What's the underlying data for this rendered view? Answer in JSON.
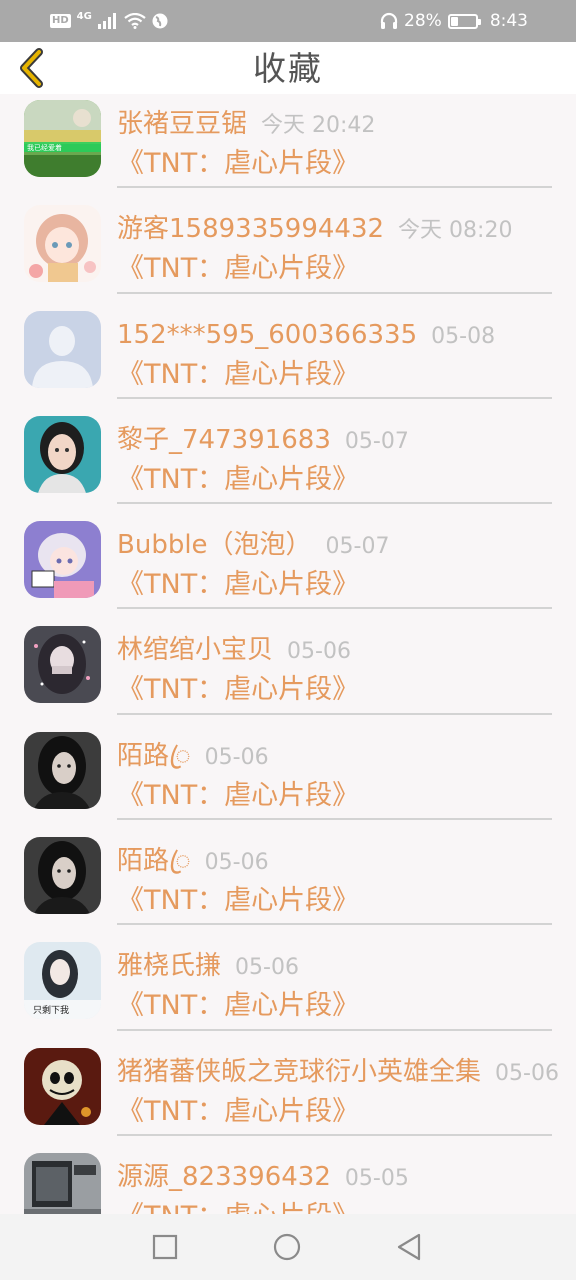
{
  "status_bar": {
    "hd": "HD",
    "network": "4G",
    "battery_text": "28%",
    "battery_level": 0.28,
    "time": "8:43",
    "icons": [
      "signal-icon",
      "wifi-icon",
      "globe-icon",
      "headset-icon",
      "battery-icon"
    ]
  },
  "header": {
    "title": "收藏",
    "back_icon": "chevron-left-icon",
    "accent": "#e6b400"
  },
  "colors": {
    "accent_text": "#e59a5e",
    "timestamp_text": "#c2c2c2",
    "divider": "#d3d3d3"
  },
  "list": {
    "items": [
      {
        "nickname": "张褚豆豆锯",
        "time": "今天 20:42",
        "work": "《TNT：虐心片段》",
        "avatar_badge": "我已经爱着"
      },
      {
        "nickname": "游客1589335994432",
        "time": "今天 08:20",
        "work": "《TNT：虐心片段》"
      },
      {
        "nickname": "152***595_600366335",
        "time": "05-08",
        "work": "《TNT：虐心片段》"
      },
      {
        "nickname": "黎子_747391683",
        "time": "05-07",
        "work": "《TNT：虐心片段》"
      },
      {
        "nickname": "Bubble（泡泡）",
        "time": "05-07",
        "work": "《TNT：虐心片段》"
      },
      {
        "nickname": "林绾绾小宝贝",
        "time": "05-06",
        "work": "《TNT：虐心片段》"
      },
      {
        "nickname": "陌路ꦿ",
        "time": "05-06",
        "work": "《TNT：虐心片段》"
      },
      {
        "nickname": "陌路ꦿ",
        "time": "05-06",
        "work": "《TNT：虐心片段》"
      },
      {
        "nickname": "雅桡氏搛",
        "time": "05-06",
        "work": "《TNT：虐心片段》",
        "avatar_badge": "只剩下我"
      },
      {
        "nickname": "猪猪蕃侠皈之竞球衍小英雄全集",
        "time": "05-06",
        "work": "《TNT：虐心片段》"
      },
      {
        "nickname": "源源_823396432",
        "time": "05-05",
        "work": "《TNT：虐心片段》"
      }
    ]
  },
  "nav_bar": {
    "icons": [
      "recent-apps-icon",
      "home-icon",
      "back-triangle-icon"
    ]
  }
}
